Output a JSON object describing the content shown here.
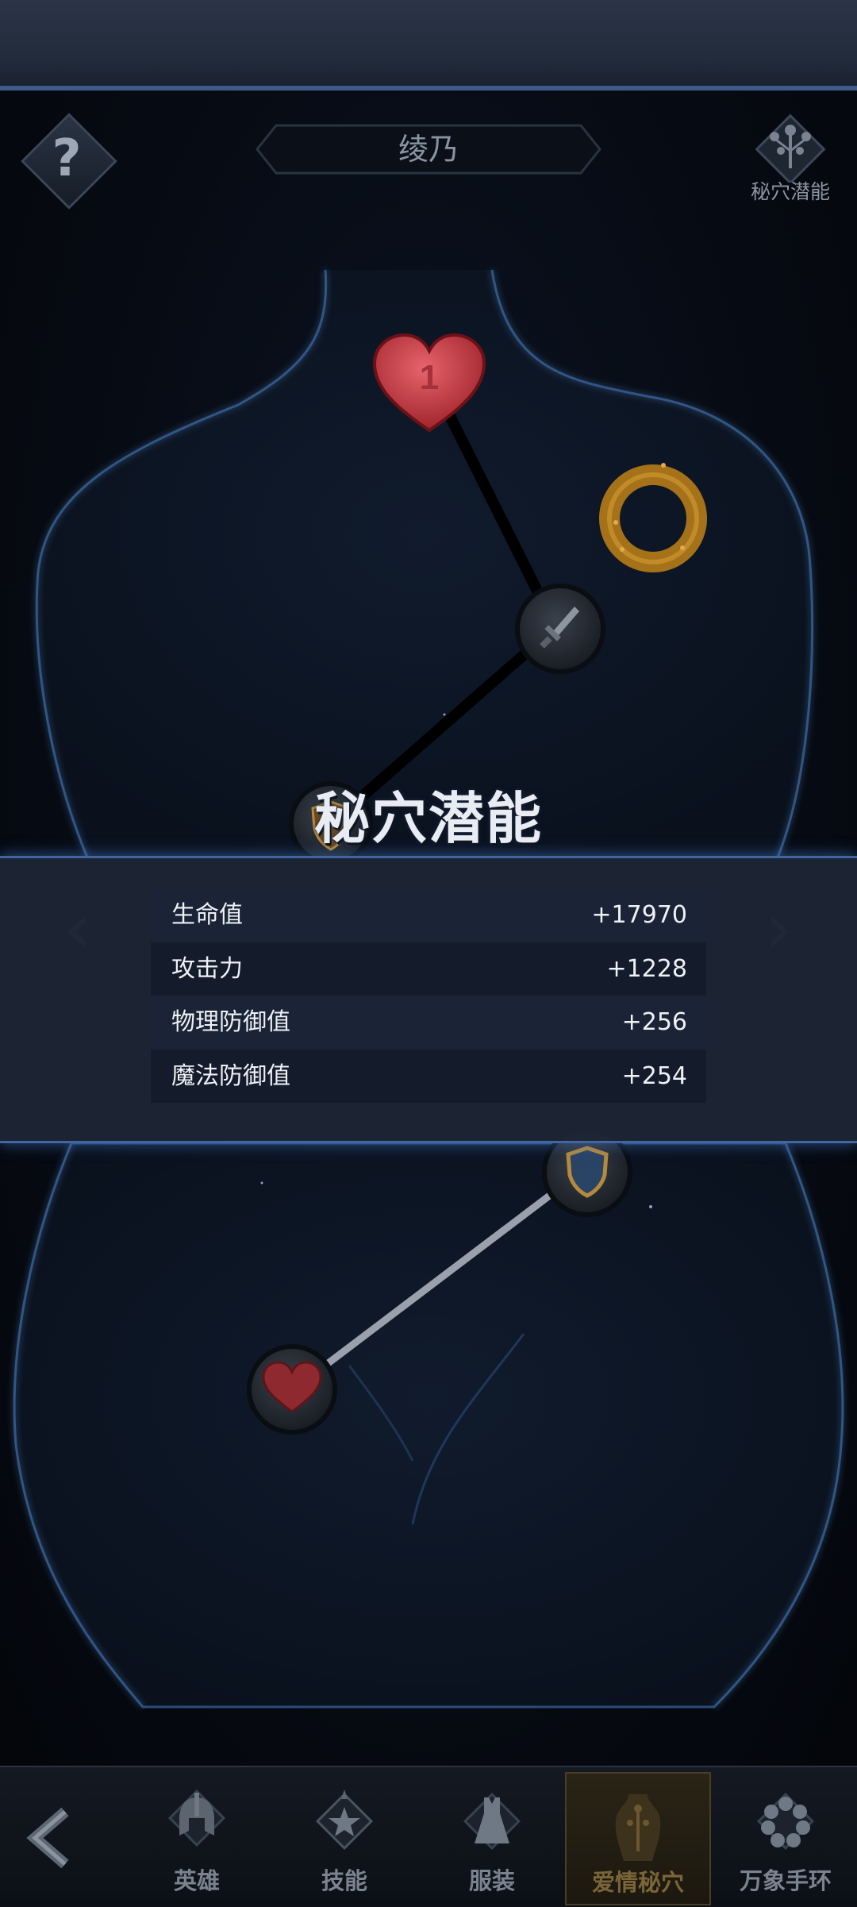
{
  "header": {
    "character_name": "绫乃",
    "help_icon": "question-mark-icon",
    "mystic_button_label": "秘穴潜能",
    "mystic_button_icon": "skill-tree-icon"
  },
  "acupoints": {
    "node_1_number": "1",
    "icons": [
      "heart-icon",
      "sword-icon",
      "ring-icon",
      "shield-icon",
      "heart-icon"
    ]
  },
  "potential_panel": {
    "title": "秘穴潜能",
    "stats": [
      {
        "label": "生命值",
        "value": "+17970"
      },
      {
        "label": "攻击力",
        "value": "+1228"
      },
      {
        "label": "物理防御值",
        "value": "+256"
      },
      {
        "label": "魔法防御值",
        "value": "+254"
      }
    ]
  },
  "bottom_nav": {
    "back_icon": "chevron-left-icon",
    "tabs": [
      {
        "label": "英雄",
        "icon": "helmet-icon",
        "active": false
      },
      {
        "label": "技能",
        "icon": "skill-star-icon",
        "active": false
      },
      {
        "label": "服装",
        "icon": "dress-icon",
        "active": false
      },
      {
        "label": "爱情秘穴",
        "icon": "body-acupoint-icon",
        "active": true
      },
      {
        "label": "万象手环",
        "icon": "bracelet-icon",
        "active": false
      }
    ]
  },
  "colors": {
    "accent_blue": "#4166a2",
    "heart_red": "#c2353b",
    "ring_gold": "#c98a1c",
    "active_tab_text": "#7a6538"
  }
}
